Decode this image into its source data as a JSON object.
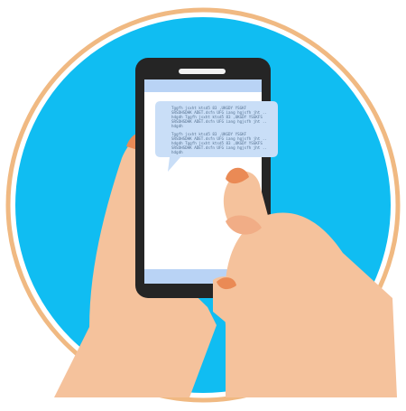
{
  "illustration": {
    "subject": "hands holding smartphone with chat message bubble",
    "colors": {
      "circle_fill": "#10bdf2",
      "ring": "#f0b982",
      "phone_body": "#252525",
      "screen": "#ffffff",
      "screen_bar": "#b9d3f5",
      "bubble": "#c9def7",
      "skin": "#f5c29c",
      "skin_shadow": "#f1ad86",
      "nail": "#ea8a55"
    },
    "message_lines": [
      "Tggfh   jsxht  ktsd5  83  ,UKGDY  YSGKF",
      "SRSDHSDHK ADET.dsfn UFG iang hgjsfh jht ..",
      "hdgdh  Tggfh  jsxht ktsd5 83 ,UKGDY YSGKFS",
      "SRSDHSDHK ADET.dsfn UFG iang hgjsfh jht ..",
      "hdgdh",
      "Tggfh   jsxht  ktsd5  83  ,UKGDY  YSGKF",
      "SRSDHSDHK ADET.dsfn UFG iang hgjsfh jht ..",
      "hdgdh  Tggfh  jsxht ktsd5 83 ,UKGDY YSGKFS",
      "SRSDHSDHK ADET.dsfn UFG iang hgjsfh jht ..",
      "hdgdh"
    ]
  }
}
